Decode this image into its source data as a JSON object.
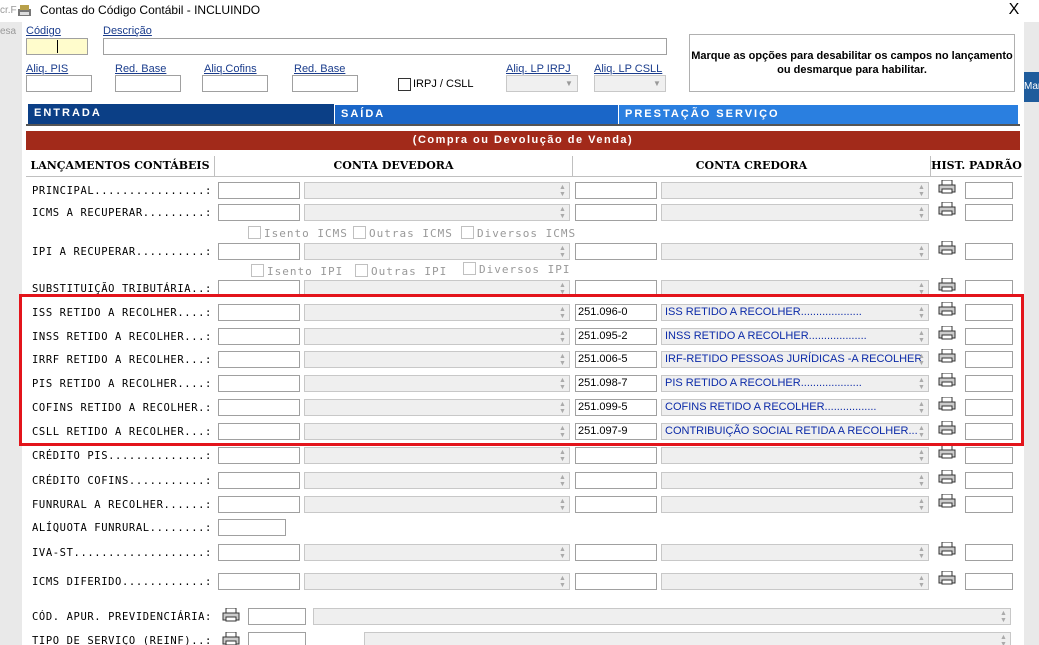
{
  "window": {
    "title": "Contas do Código Contábil  -  INCLUINDO",
    "close_label": "X"
  },
  "background": {
    "left_texts": [
      "cr.F",
      "esa"
    ],
    "right_text": "Mar"
  },
  "header": {
    "codigo_label": "Código",
    "descricao_label": "Descrição",
    "aliq_pis_label": "Aliq. PIS",
    "red_base1_label": "Red. Base",
    "aliq_cofins_label": "Aliq.Cofins",
    "red_base2_label": "Red. Base",
    "irpj_csll_label": "IRPJ / CSLL",
    "aliq_lp_irpj_label": "Aliq. LP IRPJ",
    "aliq_lp_csll_label": "Aliq. LP CSLL",
    "info_text": "Marque as opções para desabilitar os campos no lançamento ou desmarque para habilitar."
  },
  "tabs": [
    {
      "label": "ENTRADA",
      "color": "#0b3f86"
    },
    {
      "label": "SAÍDA",
      "color": "#1a66c8"
    },
    {
      "label": "PRESTAÇÃO SERVIÇO",
      "color": "#2a7fe0"
    }
  ],
  "subtitle": "(Compra ou Devolução de Venda)",
  "columns": {
    "lanc": "LANÇAMENTOS CONTÁBEIS",
    "devedora": "CONTA DEVEDORA",
    "credora": "CONTA CREDORA",
    "hist": "HIST. PADRÃO"
  },
  "rows": {
    "principal": {
      "label": "PRINCIPAL................:",
      "cred_code": "",
      "cred_desc": ""
    },
    "icms": {
      "label": "ICMS A RECUPERAR.........:",
      "cred_code": "",
      "cred_desc": ""
    },
    "ipi": {
      "label": "IPI A RECUPERAR..........:",
      "cred_code": "",
      "cred_desc": ""
    },
    "subst": {
      "label": "SUBSTITUIÇÃO TRIBUTÁRIA..:",
      "cred_code": "",
      "cred_desc": ""
    },
    "iss": {
      "label": "ISS RETIDO A RECOLHER....:",
      "cred_code": "251.096-0",
      "cred_desc": "ISS RETIDO A RECOLHER...................."
    },
    "inss": {
      "label": "INSS RETIDO A RECOLHER...:",
      "cred_code": "251.095-2",
      "cred_desc": "INSS RETIDO A RECOLHER..................."
    },
    "irrf": {
      "label": "IRRF RETIDO A RECOLHER...:",
      "cred_code": "251.006-5",
      "cred_desc": "IRF-RETIDO PESSOAS JURÍDICAS -A RECOLHER"
    },
    "pis": {
      "label": "PIS RETIDO A RECOLHER....:",
      "cred_code": "251.098-7",
      "cred_desc": "PIS RETIDO A RECOLHER...................."
    },
    "cofins": {
      "label": "COFINS RETIDO A RECOLHER.:",
      "cred_code": "251.099-5",
      "cred_desc": "COFINS RETIDO A RECOLHER................."
    },
    "csll": {
      "label": "CSLL RETIDO A RECOLHER...:",
      "cred_code": "251.097-9",
      "cred_desc": "CONTRIBUIÇÃO SOCIAL RETIDA A RECOLHER..."
    },
    "credpis": {
      "label": "CRÉDITO PIS..............:"
    },
    "credcofins": {
      "label": "CRÉDITO COFINS...........:"
    },
    "funrural": {
      "label": "FUNRURAL A RECOLHER......:"
    },
    "aliqfunrural": {
      "label": "ALÍQUOTA FUNRURAL........:"
    },
    "ivast": {
      "label": "IVA-ST...................:"
    },
    "icmsdif": {
      "label": "ICMS DIFERIDO............:"
    },
    "codapur": {
      "label": "CÓD. APUR. PREVIDENCIÁRIA:"
    },
    "tiposerv": {
      "label": "TIPO DE SERVIÇO (REINF)..:"
    }
  },
  "icms_checks": [
    "Isento ICMS",
    "Outras ICMS",
    "Diversos ICMS"
  ],
  "ipi_checks": [
    "Isento IPI",
    "Outras IPI",
    "Diversos IPI"
  ],
  "colors": {
    "highlight_border": "#e3141b",
    "subtitle_bar": "#a22a1a",
    "desc_text": "#0b2aa8"
  }
}
